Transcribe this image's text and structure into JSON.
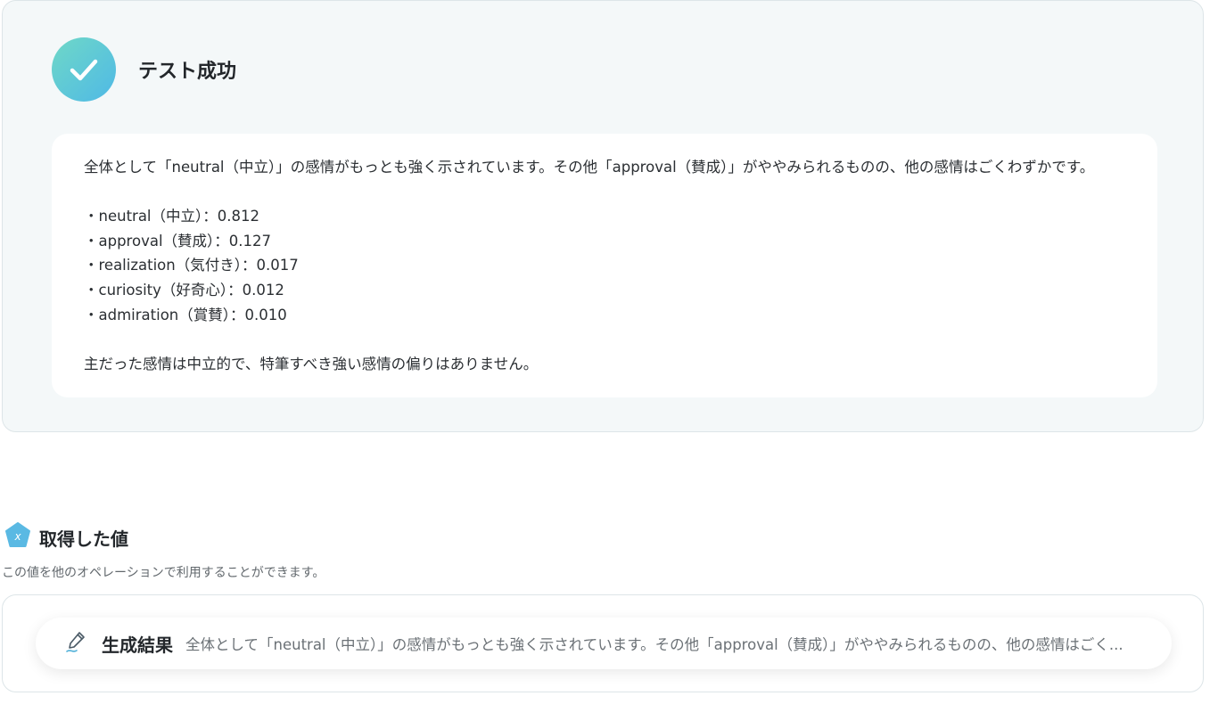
{
  "success": {
    "title": "テスト成功",
    "icon": "check-icon",
    "accent_colors": [
      "#6fd8c7",
      "#4fb9e6"
    ]
  },
  "result": {
    "summary": "全体として「neutral（中立）」の感情がもっとも強く示されています。その他「approval（賛成）」がややみられるものの、他の感情はごくわずかです。",
    "items": [
      "・neutral（中立）：0.812",
      "・approval（賛成）：0.127",
      "・realization（気付き）：0.017",
      "・curiosity（好奇心）：0.012",
      "・admiration（賞賛）：0.010"
    ],
    "conclusion": "主だった感情は中立的で、特筆すべき強い感情の偏りはありません。"
  },
  "values": {
    "title": "取得した値",
    "icon": "variable-icon",
    "description": "この値を他のオペレーションで利用することができます。",
    "item": {
      "icon": "edit-pen-icon",
      "label": "生成結果",
      "value": "全体として「neutral（中立）」の感情がもっとも強く示されています。その他「approval（賛成）」がややみられるものの、他の感情はごく..."
    }
  }
}
